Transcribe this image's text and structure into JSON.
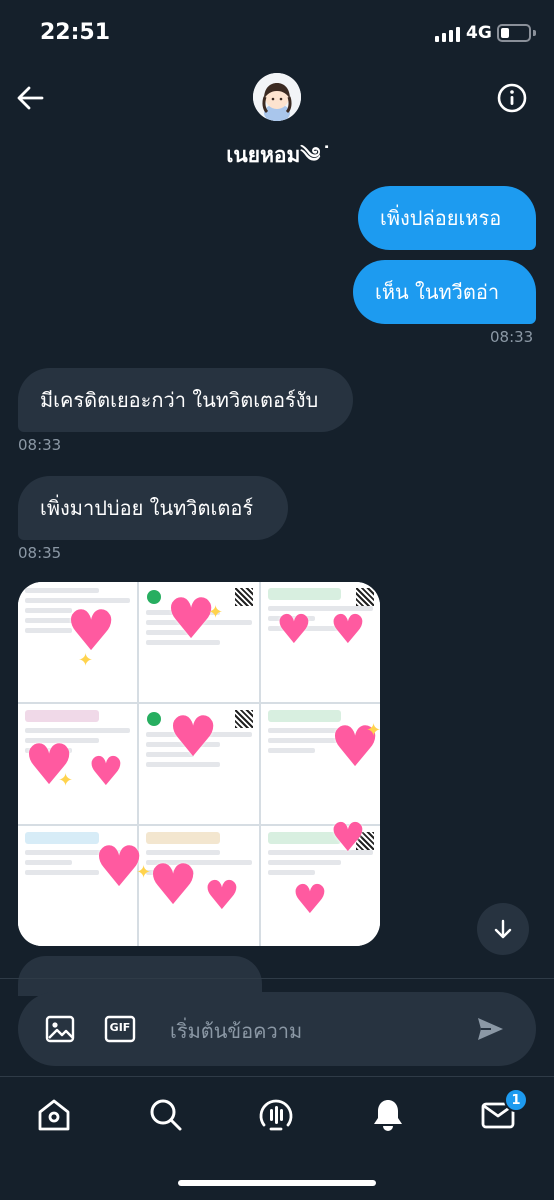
{
  "status_bar": {
    "time": "22:51",
    "network": "4G"
  },
  "header": {
    "name": "เนยหอม༄ ͘",
    "avatar": "avatar-girl-sticker"
  },
  "messages": [
    {
      "direction": "out",
      "text": "เพิ่งปล่อยเหรอ"
    },
    {
      "direction": "out",
      "text": "เห็น ในทวีตอ่า"
    },
    {
      "direction": "meta",
      "time": "08:33"
    },
    {
      "direction": "in",
      "text": "มีเครดิตเยอะกว่า ในทวิตเตอร์งับ"
    },
    {
      "direction": "meta",
      "time": "08:33"
    },
    {
      "direction": "in",
      "text": "เพิ่งมาปบ่อย ในทวิตเตอร์"
    },
    {
      "direction": "meta",
      "time": "08:35"
    }
  ],
  "media": {
    "kind": "image-collage",
    "subject": "transfer-slip-collage-with-heart-stickers"
  },
  "composer": {
    "placeholder": "เริ่มต้นข้อความ",
    "gif_label": "GIF"
  },
  "tabbar": {
    "notification_count": "1"
  },
  "colors": {
    "background": "#15202b",
    "accent": "#1d9bf0",
    "bubble_in": "#273340",
    "muted": "#8b98a5"
  }
}
